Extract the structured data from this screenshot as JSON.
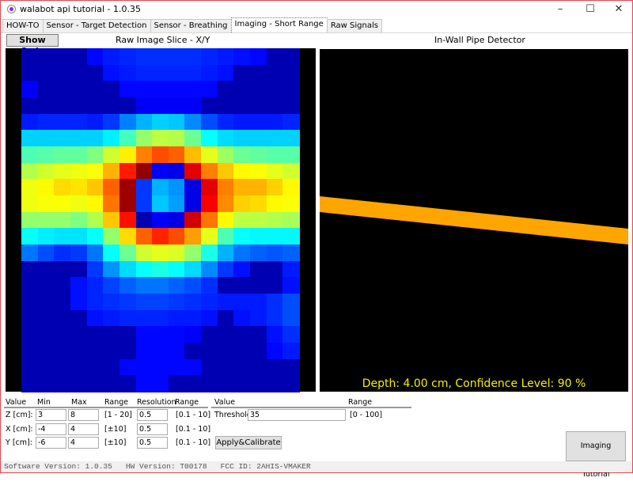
{
  "window": {
    "title": "walabot api tutorial - 1.0.35",
    "controls": {
      "minimize": "–",
      "maximize": "☐",
      "close": "✕"
    }
  },
  "tabs": [
    {
      "label": "HOW-TO",
      "active": false
    },
    {
      "label": "Sensor - Target Detection",
      "active": false
    },
    {
      "label": "Sensor - Breathing",
      "active": false
    },
    {
      "label": "Imaging - Short Range",
      "active": true
    },
    {
      "label": "Raw Signals",
      "active": false
    }
  ],
  "toolbar": {
    "show_code_label": "Show Code"
  },
  "raw_image": {
    "title": "Raw Image Slice - X/Y",
    "colormap": "jet",
    "rows": 21,
    "cols": 17,
    "values": [
      [
        0.05,
        0.05,
        0.05,
        0.05,
        0.13,
        0.15,
        0.16,
        0.17,
        0.17,
        0.17,
        0.17,
        0.16,
        0.15,
        0.14,
        0.13,
        0.05,
        0.05
      ],
      [
        0.05,
        0.05,
        0.05,
        0.05,
        0.05,
        0.14,
        0.15,
        0.16,
        0.16,
        0.16,
        0.16,
        0.15,
        0.14,
        0.05,
        0.05,
        0.05,
        0.05
      ],
      [
        0.12,
        0.05,
        0.05,
        0.05,
        0.05,
        0.05,
        0.13,
        0.13,
        0.13,
        0.13,
        0.13,
        0.13,
        0.05,
        0.05,
        0.05,
        0.05,
        0.05
      ],
      [
        0.05,
        0.05,
        0.05,
        0.05,
        0.05,
        0.05,
        0.05,
        0.12,
        0.12,
        0.12,
        0.12,
        0.05,
        0.05,
        0.05,
        0.05,
        0.05,
        0.05
      ],
      [
        0.15,
        0.16,
        0.16,
        0.16,
        0.15,
        0.18,
        0.25,
        0.3,
        0.33,
        0.32,
        0.26,
        0.2,
        0.16,
        0.15,
        0.15,
        0.15,
        0.16
      ],
      [
        0.33,
        0.33,
        0.33,
        0.33,
        0.33,
        0.36,
        0.44,
        0.52,
        0.56,
        0.55,
        0.48,
        0.38,
        0.34,
        0.33,
        0.33,
        0.33,
        0.33
      ],
      [
        0.45,
        0.46,
        0.47,
        0.47,
        0.5,
        0.58,
        0.64,
        0.75,
        0.8,
        0.78,
        0.69,
        0.6,
        0.53,
        0.48,
        0.47,
        0.46,
        0.46
      ],
      [
        0.55,
        0.58,
        0.6,
        0.61,
        0.62,
        0.7,
        0.85,
        0.98,
        0.12,
        0.1,
        0.9,
        0.75,
        0.68,
        0.63,
        0.62,
        0.6,
        0.58
      ],
      [
        0.61,
        0.63,
        0.66,
        0.65,
        0.68,
        0.78,
        0.97,
        0.18,
        0.3,
        0.27,
        0.1,
        0.9,
        0.75,
        0.7,
        0.7,
        0.67,
        0.63
      ],
      [
        0.61,
        0.62,
        0.62,
        0.61,
        0.63,
        0.76,
        0.97,
        0.18,
        0.32,
        0.28,
        0.1,
        0.88,
        0.74,
        0.67,
        0.66,
        0.63,
        0.62
      ],
      [
        0.52,
        0.52,
        0.52,
        0.5,
        0.55,
        0.68,
        0.86,
        0.05,
        0.12,
        0.1,
        0.92,
        0.76,
        0.63,
        0.56,
        0.56,
        0.55,
        0.54
      ],
      [
        0.38,
        0.36,
        0.35,
        0.35,
        0.38,
        0.52,
        0.66,
        0.78,
        0.84,
        0.8,
        0.72,
        0.6,
        0.45,
        0.38,
        0.37,
        0.37,
        0.37
      ],
      [
        0.24,
        0.2,
        0.17,
        0.18,
        0.24,
        0.38,
        0.48,
        0.58,
        0.6,
        0.59,
        0.52,
        0.4,
        0.3,
        0.24,
        0.22,
        0.21,
        0.22
      ],
      [
        0.05,
        0.05,
        0.05,
        0.05,
        0.18,
        0.27,
        0.34,
        0.38,
        0.4,
        0.38,
        0.34,
        0.26,
        0.18,
        0.14,
        0.05,
        0.05,
        0.15
      ],
      [
        0.05,
        0.05,
        0.05,
        0.14,
        0.16,
        0.19,
        0.22,
        0.24,
        0.24,
        0.22,
        0.2,
        0.17,
        0.05,
        0.05,
        0.05,
        0.05,
        0.14
      ],
      [
        0.05,
        0.05,
        0.05,
        0.14,
        0.16,
        0.17,
        0.18,
        0.19,
        0.19,
        0.18,
        0.17,
        0.16,
        0.15,
        0.15,
        0.15,
        0.17,
        0.2
      ],
      [
        0.05,
        0.05,
        0.05,
        0.05,
        0.14,
        0.15,
        0.16,
        0.16,
        0.16,
        0.15,
        0.15,
        0.14,
        0.05,
        0.14,
        0.15,
        0.17,
        0.2
      ],
      [
        0.05,
        0.05,
        0.05,
        0.05,
        0.05,
        0.05,
        0.05,
        0.13,
        0.13,
        0.13,
        0.12,
        0.05,
        0.05,
        0.05,
        0.05,
        0.14,
        0.17
      ],
      [
        0.05,
        0.05,
        0.05,
        0.05,
        0.05,
        0.05,
        0.05,
        0.13,
        0.13,
        0.13,
        0.05,
        0.05,
        0.05,
        0.05,
        0.05,
        0.13,
        0.15
      ],
      [
        0.05,
        0.05,
        0.05,
        0.05,
        0.05,
        0.05,
        0.13,
        0.13,
        0.13,
        0.13,
        0.13,
        0.05,
        0.05,
        0.05,
        0.05,
        0.05,
        0.05
      ],
      [
        0.05,
        0.05,
        0.05,
        0.05,
        0.05,
        0.05,
        0.05,
        0.13,
        0.13,
        0.05,
        0.05,
        0.05,
        0.05,
        0.05,
        0.05,
        0.05,
        0.05
      ]
    ]
  },
  "pipe_detector": {
    "title": "In-Wall Pipe Detector",
    "readout": "Depth: 4.00 cm, Confidence Level: 90 %",
    "depth_cm": 4.0,
    "confidence_percent": 90,
    "pipe_color": "#FFA500",
    "readout_color": "#F2F200"
  },
  "arena": {
    "headers": {
      "value": "Value",
      "min": "Min",
      "max": "Max",
      "range": "Range",
      "resolution": "Resolution",
      "res_range": "Range"
    },
    "rows": [
      {
        "label": "Z [cm]:",
        "min": "3",
        "max": "8",
        "range": "[1 - 20]",
        "resolution": "0.5",
        "res_range": "[0.1 - 10]"
      },
      {
        "label": "X [cm]:",
        "min": "-4",
        "max": "4",
        "range": "[±10]",
        "resolution": "0.5",
        "res_range": "[0.1 - 10]"
      },
      {
        "label": "Y [cm]:",
        "min": "-6",
        "max": "4",
        "range": "[±10]",
        "resolution": "0.5",
        "res_range": "[0.1 - 10]"
      }
    ]
  },
  "dynamic": {
    "headers": {
      "value": "Value",
      "range": "Range"
    },
    "threshold_label": "Threshold:",
    "threshold_value": "35",
    "threshold_range": "[0 - 100]",
    "apply_label": "Apply&Calibrate"
  },
  "tutorial_button": "Imaging Tutorial",
  "status": {
    "software_version": "Software Version: 1.0.35",
    "hw_version": "HW Version: T00178",
    "fcc_id": "FCC ID: 2AHIS-VMAKER"
  }
}
